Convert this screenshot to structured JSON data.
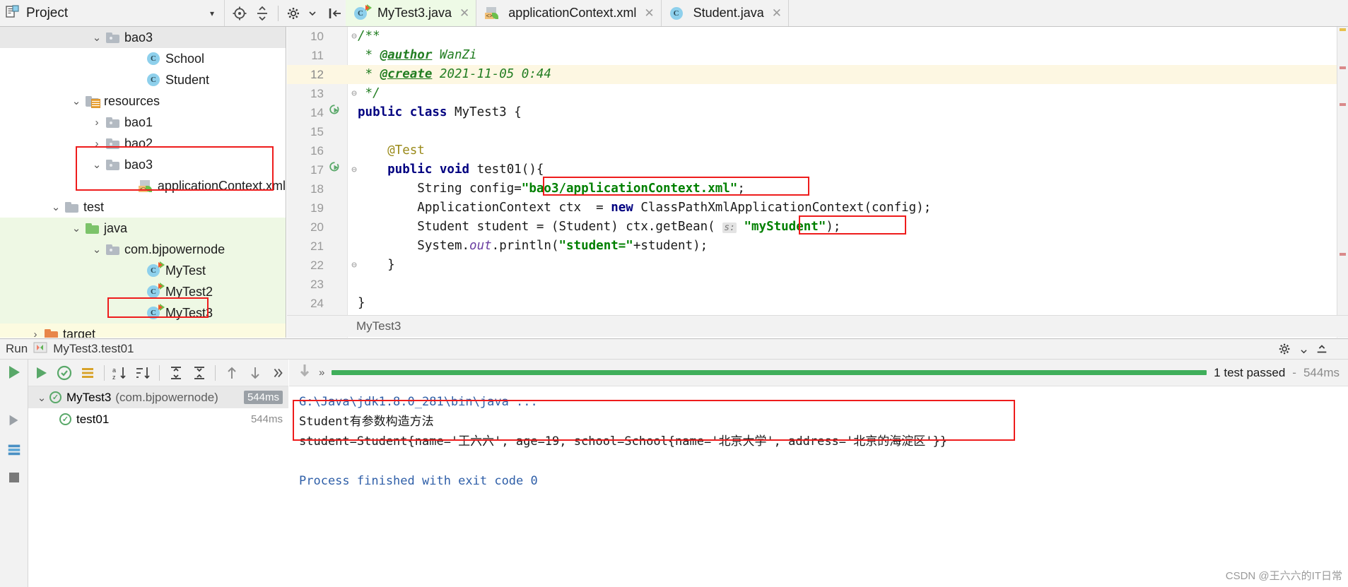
{
  "toolbar": {
    "project_label": "Project",
    "project_icon": "project-view-icon",
    "caret": "▾",
    "icons": [
      "locate-icon",
      "collapse-all-icon",
      "settings-gear-icon",
      "hide-icon"
    ]
  },
  "tabs": [
    {
      "label": "MyTest3.java",
      "icon": "java-class-runnable-icon",
      "active": true,
      "close": "✕"
    },
    {
      "label": "applicationContext.xml",
      "icon": "spring-xml-icon",
      "active": false,
      "close": "✕"
    },
    {
      "label": "Student.java",
      "icon": "java-class-icon",
      "active": false,
      "close": "✕"
    }
  ],
  "project_tree": [
    {
      "label": "bao3",
      "indent": 4,
      "arrow": "⌄",
      "icon": "folder",
      "row_style": "sel-gray"
    },
    {
      "label": "School",
      "indent": 6,
      "arrow": "",
      "icon": "jclass",
      "row_style": ""
    },
    {
      "label": "Student",
      "indent": 6,
      "arrow": "",
      "icon": "jclass",
      "row_style": ""
    },
    {
      "label": "resources",
      "indent": 3,
      "arrow": "⌄",
      "icon": "folder-res",
      "row_style": ""
    },
    {
      "label": "bao1",
      "indent": 4,
      "arrow": "›",
      "icon": "folder",
      "row_style": ""
    },
    {
      "label": "bao2",
      "indent": 4,
      "arrow": "›",
      "icon": "folder",
      "row_style": ""
    },
    {
      "label": "bao3",
      "indent": 4,
      "arrow": "⌄",
      "icon": "folder",
      "row_style": ""
    },
    {
      "label": "applicationContext.xml",
      "indent": 6,
      "arrow": "",
      "icon": "xml",
      "row_style": ""
    },
    {
      "label": "test",
      "indent": 2,
      "arrow": "⌄",
      "icon": "folder-plain",
      "row_style": ""
    },
    {
      "label": "java",
      "indent": 3,
      "arrow": "⌄",
      "icon": "folder-green",
      "row_style": "hl-green"
    },
    {
      "label": "com.bjpowernode",
      "indent": 4,
      "arrow": "⌄",
      "icon": "folder",
      "row_style": "hl-green"
    },
    {
      "label": "MyTest",
      "indent": 6,
      "arrow": "",
      "icon": "jclass-run",
      "row_style": "hl-green"
    },
    {
      "label": "MyTest2",
      "indent": 6,
      "arrow": "",
      "icon": "jclass-run",
      "row_style": "hl-green"
    },
    {
      "label": "MyTest3",
      "indent": 6,
      "arrow": "",
      "icon": "jclass-run",
      "row_style": "hl-green"
    },
    {
      "label": "target",
      "indent": 1,
      "arrow": "›",
      "icon": "folder-orange",
      "row_style": "hl-yellow"
    }
  ],
  "editor": {
    "lines": [
      {
        "no": "10",
        "fold": "⊖",
        "marker": "",
        "highlight": false,
        "segs": [
          {
            "t": "/**",
            "c": "cmt"
          }
        ]
      },
      {
        "no": "11",
        "fold": "",
        "marker": "",
        "highlight": false,
        "segs": [
          {
            "t": " * ",
            "c": "cmt"
          },
          {
            "t": "@author",
            "c": "cmt-tag"
          },
          {
            "t": " WanZi",
            "c": "cmt"
          }
        ]
      },
      {
        "no": "12",
        "fold": "",
        "marker": "",
        "highlight": true,
        "segs": [
          {
            "t": " * ",
            "c": "cmt"
          },
          {
            "t": "@create",
            "c": "cmt-tag"
          },
          {
            "t": " 2021-11-05 0:44",
            "c": "cmt"
          }
        ]
      },
      {
        "no": "13",
        "fold": "⊖",
        "marker": "",
        "highlight": false,
        "segs": [
          {
            "t": " */",
            "c": "cmt"
          }
        ]
      },
      {
        "no": "14",
        "fold": "",
        "marker": "run",
        "highlight": false,
        "segs": [
          {
            "t": "public class ",
            "c": "kw"
          },
          {
            "t": "MyTest3 {",
            "c": "plain"
          }
        ]
      },
      {
        "no": "15",
        "fold": "",
        "marker": "",
        "highlight": false,
        "segs": []
      },
      {
        "no": "16",
        "fold": "",
        "marker": "",
        "highlight": false,
        "segs": [
          {
            "t": "    @Test",
            "c": "ann"
          }
        ]
      },
      {
        "no": "17",
        "fold": "⊖",
        "marker": "run",
        "highlight": false,
        "segs": [
          {
            "t": "    public void ",
            "c": "kw"
          },
          {
            "t": "test01(){",
            "c": "plain"
          }
        ]
      },
      {
        "no": "18",
        "fold": "",
        "marker": "",
        "highlight": false,
        "segs": [
          {
            "t": "        String config=",
            "c": "plain"
          },
          {
            "t": "\"bao3/applicationContext.xml\"",
            "c": "str"
          },
          {
            "t": ";",
            "c": "plain"
          }
        ]
      },
      {
        "no": "19",
        "fold": "",
        "marker": "",
        "highlight": false,
        "segs": [
          {
            "t": "        ApplicationContext ctx  = ",
            "c": "plain"
          },
          {
            "t": "new ",
            "c": "kw"
          },
          {
            "t": "ClassPathXmlApplicationContext(config);",
            "c": "plain"
          }
        ]
      },
      {
        "no": "20",
        "fold": "",
        "marker": "",
        "highlight": false,
        "segs": [
          {
            "t": "        Student student = (Student) ctx.getBean( ",
            "c": "plain"
          },
          {
            "t": "s:",
            "c": "hint"
          },
          {
            "t": " ",
            "c": "plain"
          },
          {
            "t": "\"myStudent\"",
            "c": "str"
          },
          {
            "t": ");",
            "c": "plain"
          }
        ]
      },
      {
        "no": "21",
        "fold": "",
        "marker": "",
        "highlight": false,
        "segs": [
          {
            "t": "        System.",
            "c": "plain"
          },
          {
            "t": "out",
            "c": "fld"
          },
          {
            "t": ".println(",
            "c": "plain"
          },
          {
            "t": "\"student=\"",
            "c": "str"
          },
          {
            "t": "+student);",
            "c": "plain"
          }
        ]
      },
      {
        "no": "22",
        "fold": "⊖",
        "marker": "",
        "highlight": false,
        "segs": [
          {
            "t": "    }",
            "c": "plain"
          }
        ]
      },
      {
        "no": "23",
        "fold": "",
        "marker": "",
        "highlight": false,
        "segs": []
      },
      {
        "no": "24",
        "fold": "",
        "marker": "",
        "highlight": false,
        "segs": [
          {
            "t": "}",
            "c": "plain"
          }
        ]
      }
    ],
    "breadcrumb": "MyTest3"
  },
  "run": {
    "header_label": "Run",
    "header_config": "MyTest3.test01",
    "toolbar_icons": [
      "rerun-icon",
      "rerun-failed-icon",
      "toggle-auto-test-icon",
      "sort-alpha-icon",
      "sort-duration-icon",
      "expand-all-icon",
      "collapse-all-icon",
      "prev-failed-icon",
      "next-failed-icon",
      "more-icon"
    ],
    "tree": [
      {
        "label": "MyTest3",
        "sub": "(com.bjpowernode)",
        "time": "544ms",
        "arrow": "⌄",
        "selected": true
      },
      {
        "label": "test01",
        "sub": "",
        "time": "544ms",
        "arrow": "",
        "selected": false
      }
    ],
    "test_status": "1 test passed",
    "test_separator": "-",
    "test_duration": "544ms",
    "console": [
      {
        "text": "G:\\Java\\jdk1.8.0_281\\bin\\java ...",
        "kind": "cmd"
      },
      {
        "text": "Student有参数构造方法",
        "kind": "usr"
      },
      {
        "text": "student=Student{name='王六六', age=19, school=School{name='北京大学', address='北京的海淀区'}}",
        "kind": "usr"
      },
      {
        "text": "",
        "kind": "usr"
      },
      {
        "text": "Process finished with exit code 0",
        "kind": "sys"
      }
    ],
    "watermark": "CSDN @王六六的IT日常"
  },
  "colors": {
    "accent_green": "#3fae5a",
    "annotation_red": "#ee1c1c",
    "string_green": "#008000",
    "keyword_blue": "#000080",
    "comment_green": "#217d21",
    "tab_active_bg": "#eefae6"
  }
}
